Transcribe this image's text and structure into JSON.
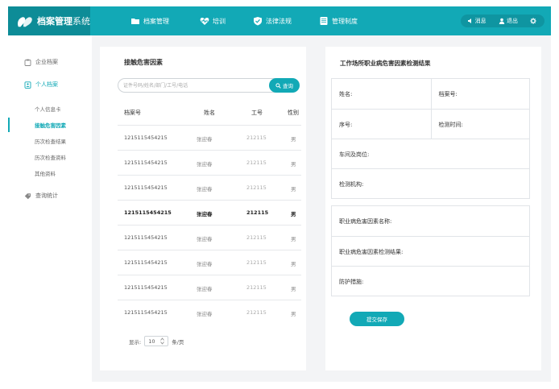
{
  "brand": {
    "title_strong": "档案管理",
    "title_light": "系统"
  },
  "nav": [
    {
      "label": "档案管理",
      "icon": "folder-icon"
    },
    {
      "label": "培训",
      "icon": "heartbeat-icon"
    },
    {
      "label": "法律法规",
      "icon": "shield-check-icon"
    },
    {
      "label": "管理制度",
      "icon": "document-icon"
    }
  ],
  "top_right": {
    "message": "消息",
    "logout": "退出",
    "settings_icon": "gear-icon"
  },
  "sidebar": {
    "groups": [
      {
        "label": "企业档案",
        "icon": "clipboard-icon"
      },
      {
        "label": "个人档案",
        "icon": "person-doc-icon"
      },
      {
        "label": "查询统计",
        "icon": "tag-icon"
      }
    ],
    "subitems": [
      "个人信息卡",
      "接触危害因素",
      "历次检查结果",
      "历次检查资料",
      "其他资料"
    ]
  },
  "left_panel": {
    "title": "接触危害因素",
    "search_placeholder": "证件号码/姓名/部门/工号/电话",
    "search_button": "查询",
    "columns": [
      "档案号",
      "姓名",
      "工号",
      "性别"
    ],
    "rows": [
      [
        "1215115454215",
        "张迎春",
        "212115",
        "男"
      ],
      [
        "1215115454215",
        "张迎春",
        "212115",
        "男"
      ],
      [
        "1215115454215",
        "张迎春",
        "212115",
        "男"
      ],
      [
        "1215115454215",
        "张迎春",
        "212115",
        "男"
      ],
      [
        "1215115454215",
        "张迎春",
        "212115",
        "男"
      ],
      [
        "1215115454215",
        "张迎春",
        "212115",
        "男"
      ],
      [
        "1215115454215",
        "张迎春",
        "212115",
        "男"
      ],
      [
        "1215115454215",
        "张迎春",
        "212115",
        "男"
      ]
    ],
    "pager": {
      "show_label": "显示:",
      "page_size": "10",
      "unit": "条/页"
    }
  },
  "right_panel": {
    "title": "工作场所职业病危害因素检测结果",
    "name_label": "姓名:",
    "record_no_label": "档案号:",
    "serial_label": "序号:",
    "test_time_label": "检测时间:",
    "workshop_label": "车间及岗位:",
    "agency_label": "检测机构:",
    "hazard_name_label": "职业病危害因素名称:",
    "hazard_result_label": "职业病危害因素检测结果:",
    "protection_label": "防护措施:",
    "submit": "提交保存"
  },
  "colors": {
    "accent": "#12a9b6",
    "brand_dark": "#0d8c97"
  }
}
